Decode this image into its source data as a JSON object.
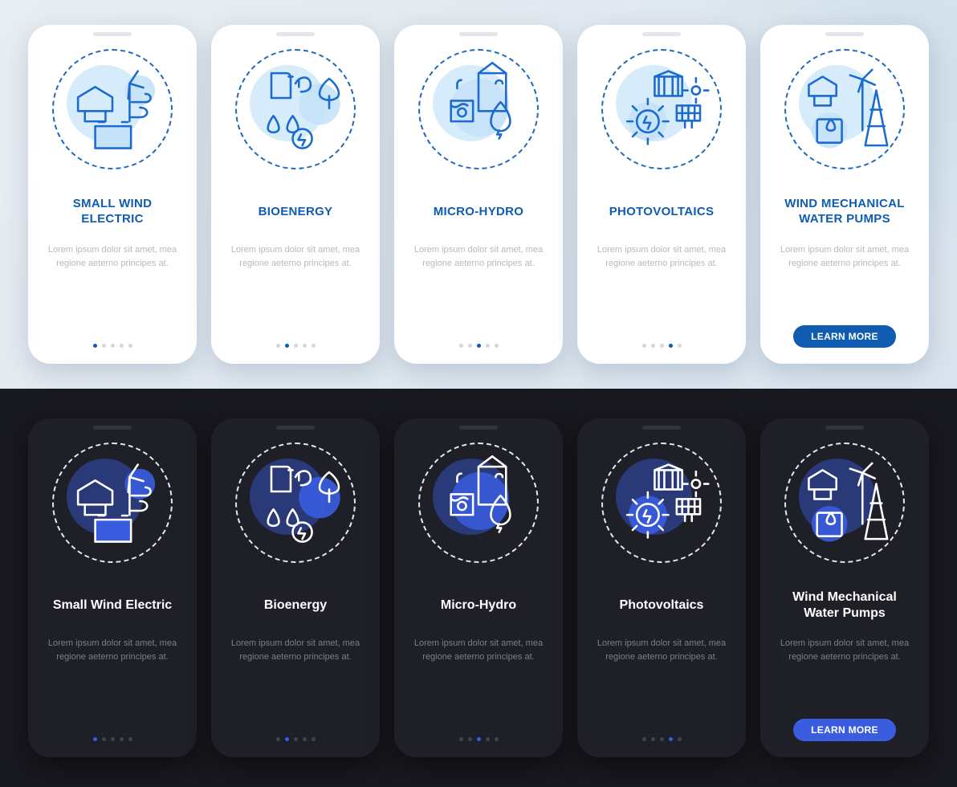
{
  "button_label": "LEARN MORE",
  "lorem": "Lorem ipsum dolor sit amet, mea regione aeterno principes at.",
  "light": {
    "slides": [
      {
        "title": "SMALL WIND ELECTRIC",
        "icon": "wind-electric-icon"
      },
      {
        "title": "BIOENERGY",
        "icon": "bioenergy-icon"
      },
      {
        "title": "MICRO-HYDRO",
        "icon": "micro-hydro-icon"
      },
      {
        "title": "PHOTOVOLTAICS",
        "icon": "photovoltaics-icon"
      },
      {
        "title": "WIND MECHANICAL WATER PUMPS",
        "icon": "wind-pump-icon"
      }
    ],
    "active_dots": [
      0,
      1,
      2,
      3,
      4
    ]
  },
  "dark": {
    "slides": [
      {
        "title": "Small Wind Electric",
        "icon": "wind-electric-icon"
      },
      {
        "title": "Bioenergy",
        "icon": "bioenergy-icon"
      },
      {
        "title": "Micro-Hydro",
        "icon": "micro-hydro-icon"
      },
      {
        "title": "Photovoltaics",
        "icon": "photovoltaics-icon"
      },
      {
        "title": "Wind Mechanical Water Pumps",
        "icon": "wind-pump-icon"
      }
    ],
    "active_dots": [
      0,
      1,
      2,
      3,
      4
    ]
  },
  "colors": {
    "accent_light": "#0f5cb0",
    "accent_dark": "#3a5de0"
  }
}
